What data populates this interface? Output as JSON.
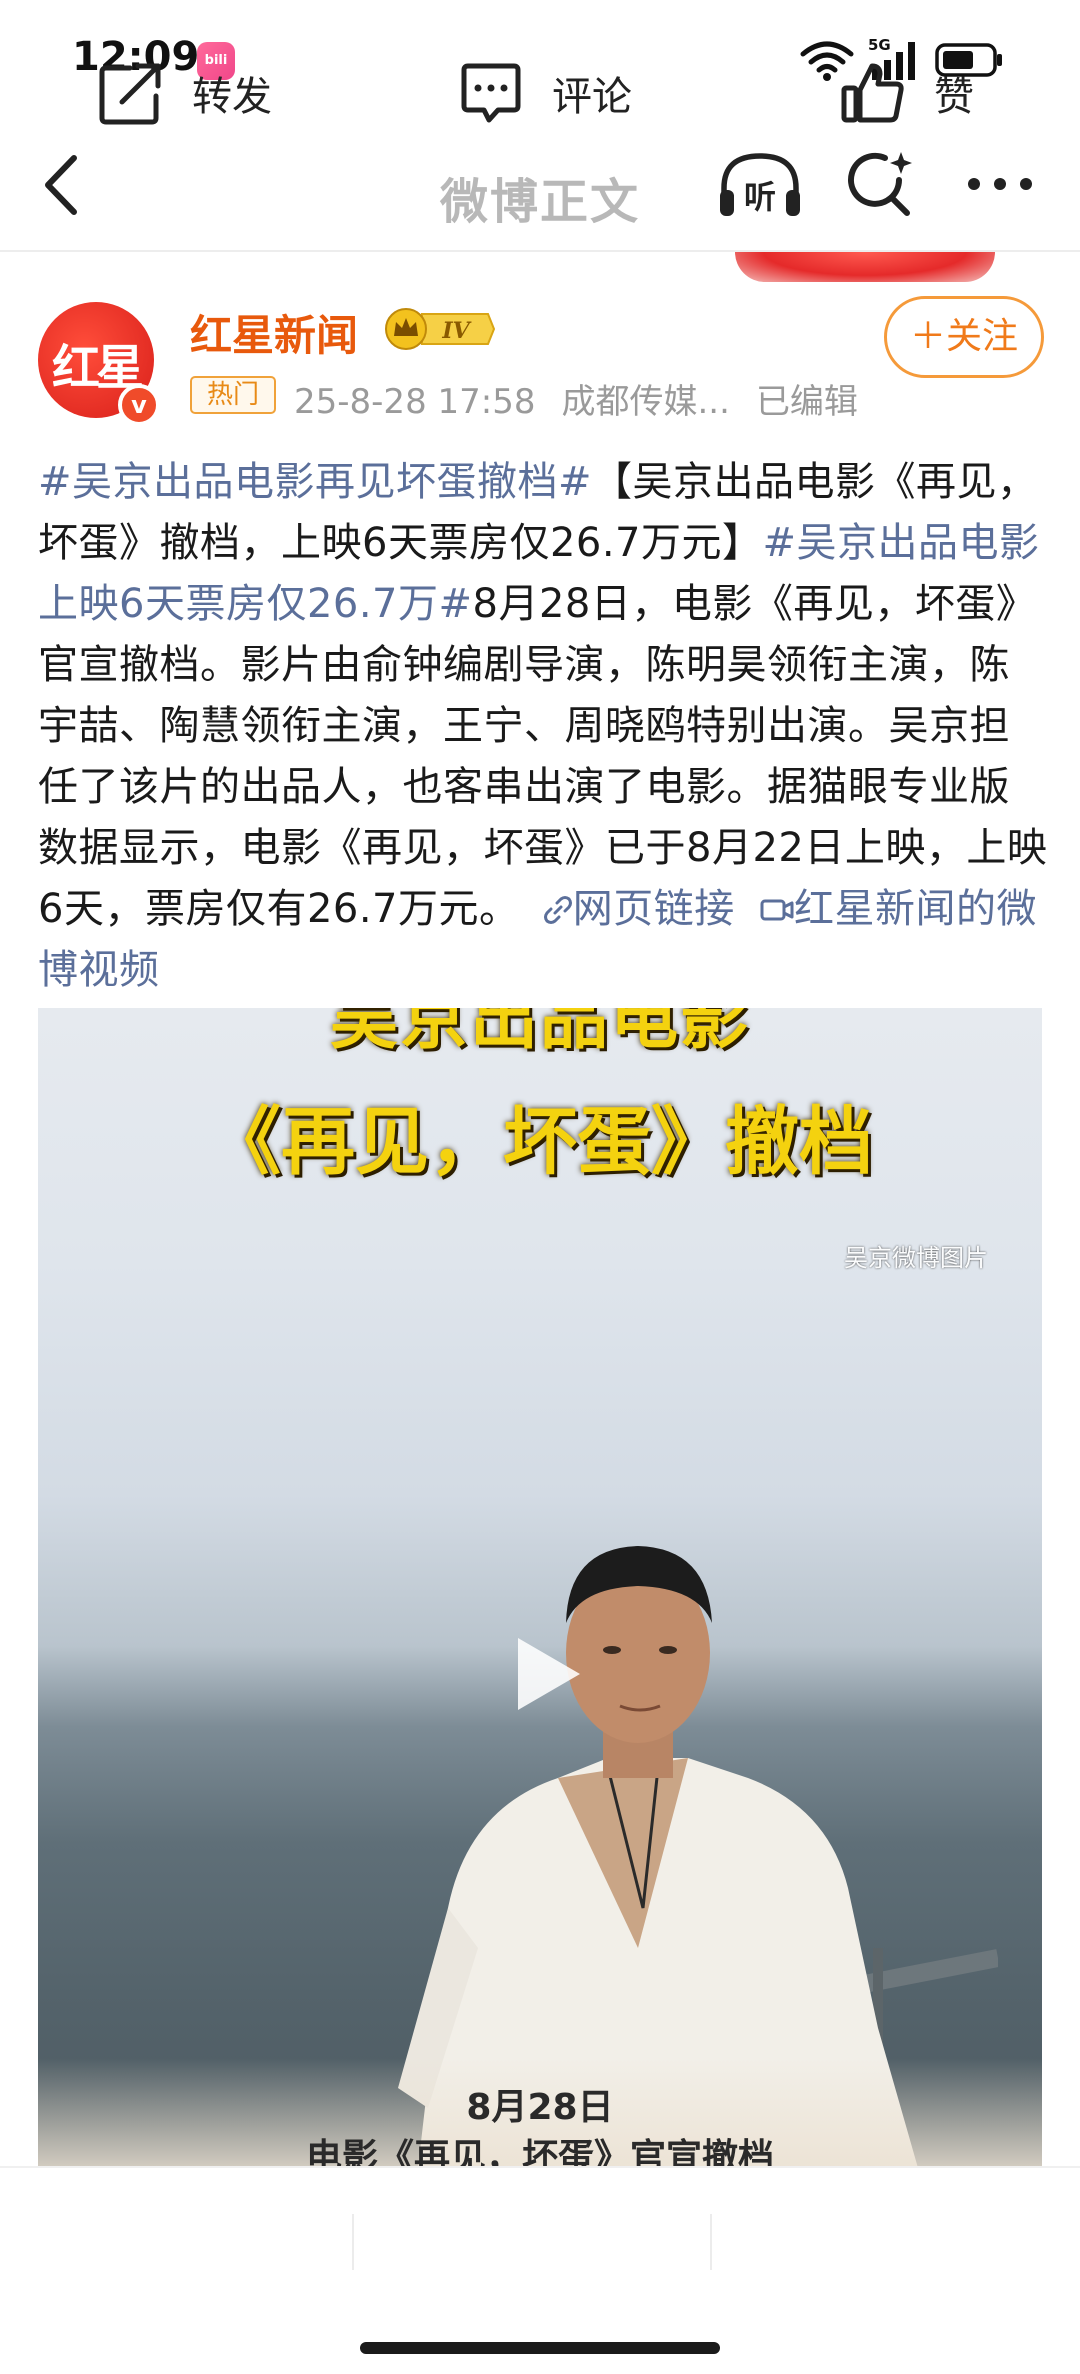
{
  "status_bar": {
    "time": "12:09",
    "app_icon_label": "bilibili",
    "network": "5G"
  },
  "nav": {
    "title": "微博正文",
    "listen_label": "听"
  },
  "post": {
    "author": "红星新闻",
    "avatar_text": "红星",
    "vip_level": "IV",
    "follow_label": "＋关注",
    "hot_tag": "热门",
    "time": "25-8-28 17:58",
    "source": "成都传媒...",
    "edited": "已编辑",
    "topic1": "#吴京出品电影再见坏蛋撤档#",
    "text1": "【吴京出品电影《再见，坏蛋》撤档，上映6天票房仅26.7万元】",
    "topic2": "#吴京出品电影上映6天票房仅26.7万#",
    "text2": "8月28日，电影《再见，坏蛋》官宣撤档。影片由俞钟编剧导演，陈明昊领衔主演，陈宇喆、陶慧领衔主演，王宁、周晓鸥特别出演。吴京担任了该片的出品人，也客串出演了电影。据猫眼专业版数据显示，电影《再见，坏蛋》已于8月22日上映，上映6天，票房仅有26.7万元。",
    "web_link": "网页链接",
    "video_link": "红星新闻的微博视频"
  },
  "video": {
    "caption_top": "吴京出品电影",
    "title": "《再见，坏蛋》撤档",
    "watermark": "吴京微博图片",
    "date": "8月28日",
    "subtitle": "电影《再见，坏蛋》官宣撤档"
  },
  "actions": {
    "repost": "转发",
    "comment": "评论",
    "like": "赞"
  },
  "colors": {
    "accent_orange": "#f07a1a",
    "topic_blue": "#5b6f9a",
    "author_orange": "#e8590c"
  },
  "icons": [
    "back-icon",
    "listen-icon",
    "search-icon",
    "more-icon",
    "play-icon",
    "repost-icon",
    "comment-icon",
    "like-icon",
    "link-icon",
    "video-link-icon"
  ]
}
